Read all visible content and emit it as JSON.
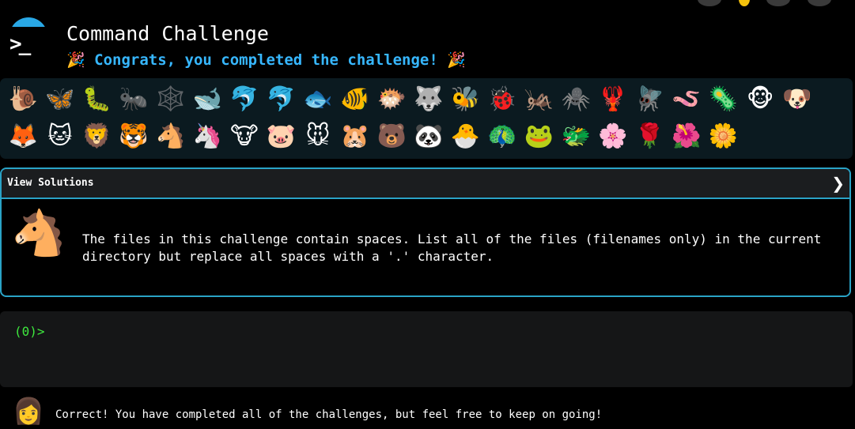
{
  "header": {
    "logo_symbol": ">_",
    "title": "Command Challenge",
    "congrats": "Congrats, you completed the challenge!",
    "party_emoji": "🎉"
  },
  "zoo": {
    "animals": [
      "🐌",
      "🦋",
      "🐛",
      "🐜",
      "🕸️",
      "🐋",
      "🐬",
      "🐬",
      "🐟",
      "🐠",
      "🐡",
      "🐺",
      "🐝",
      "🐞",
      "🦗",
      "🕷️",
      "🦞",
      "🪰",
      "🪱",
      "🦠",
      "🐵",
      "🐶",
      "🦊",
      "🐱",
      "🦁",
      "🐯",
      "🐴",
      "🦄",
      "🐮",
      "🐷",
      "🐭",
      "🐹",
      "🐻",
      "🐼",
      "🐣",
      "🦚",
      "🐸",
      "🐲",
      "🌸",
      "🌹",
      "🌺",
      "🌼"
    ]
  },
  "solutions": {
    "label": "View Solutions",
    "chevron": "❯",
    "avatar": "🐴",
    "description": "The files in this challenge contain spaces. List all of the files (filenames only) in the current directory but replace all spaces with a '.' character."
  },
  "terminal": {
    "prompt": "(0)>",
    "input_value": ""
  },
  "status": {
    "avatar": "👩",
    "message": "Correct! You have completed all of the challenges, but feel free to keep on going!"
  },
  "colors": {
    "accent": "#37b7ff",
    "border": "#2aa3c6",
    "prompt": "#3ee83e"
  }
}
